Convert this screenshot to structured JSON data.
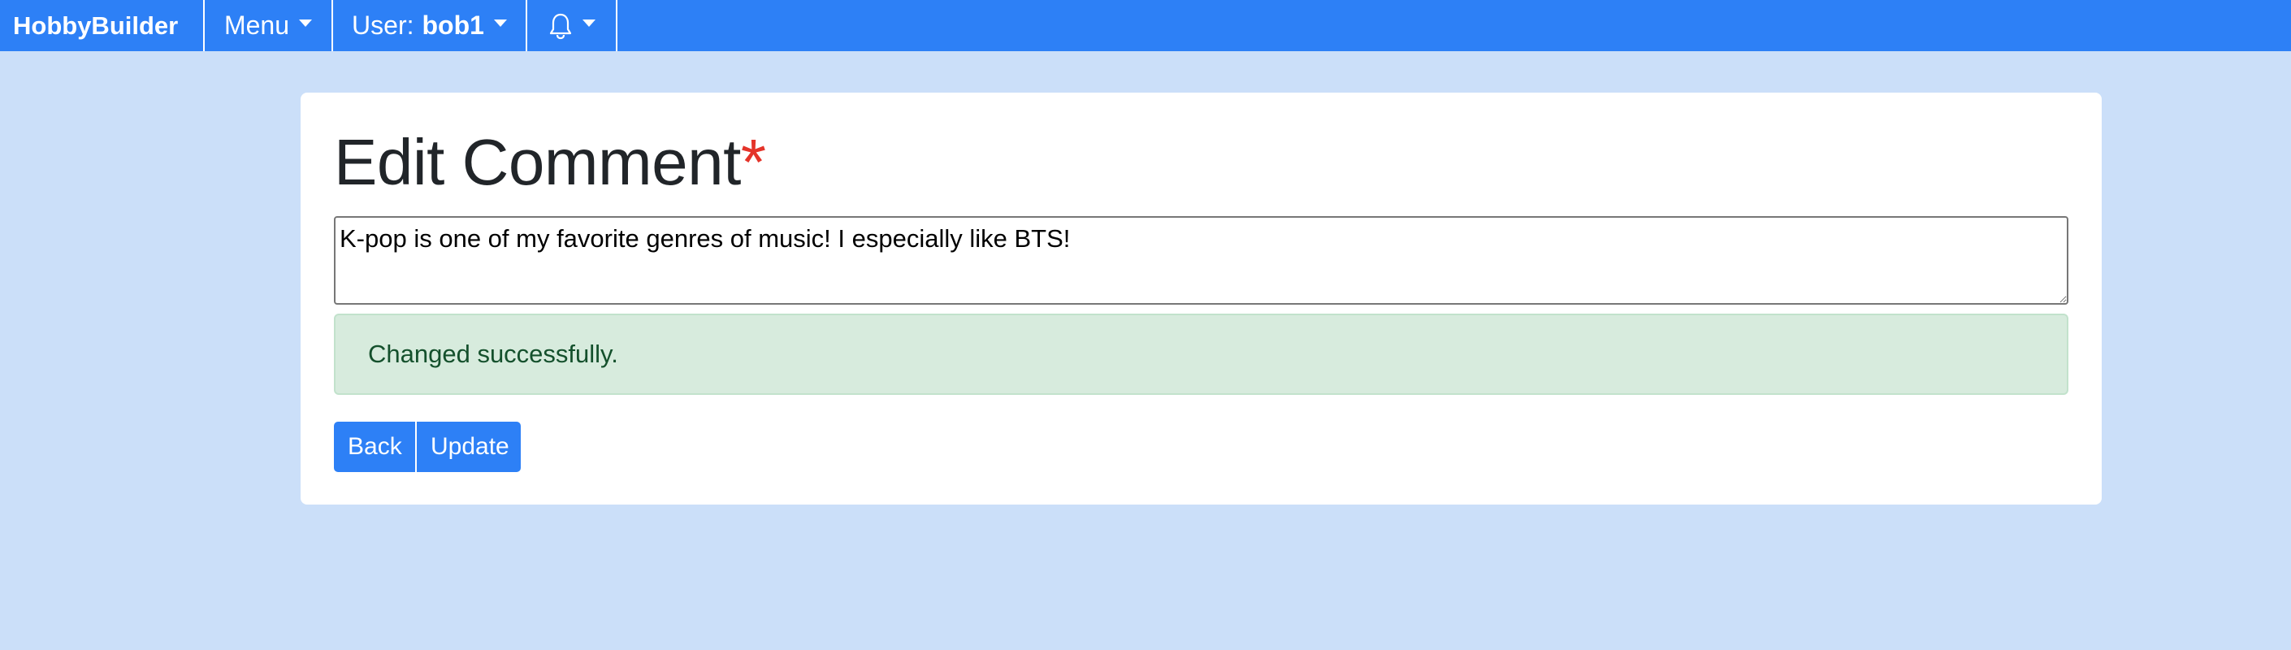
{
  "navbar": {
    "brand": "HobbyBuilder",
    "menu_label": "Menu",
    "user_prefix": "User:",
    "user_name": "bob1",
    "notifications_icon": "bell-icon"
  },
  "edit_comment": {
    "title": "Edit Comment",
    "required_marker": "*",
    "comment_value": "K-pop is one of my favorite genres of music! I especially like BTS!",
    "alert_message": "Changed successfully.",
    "back_label": "Back",
    "update_label": "Update"
  },
  "colors": {
    "primary": "#2d80f6",
    "page_background": "#cbdff9",
    "success_background": "#d7ebdd",
    "success_text": "#14502c",
    "required": "#e4342a"
  }
}
